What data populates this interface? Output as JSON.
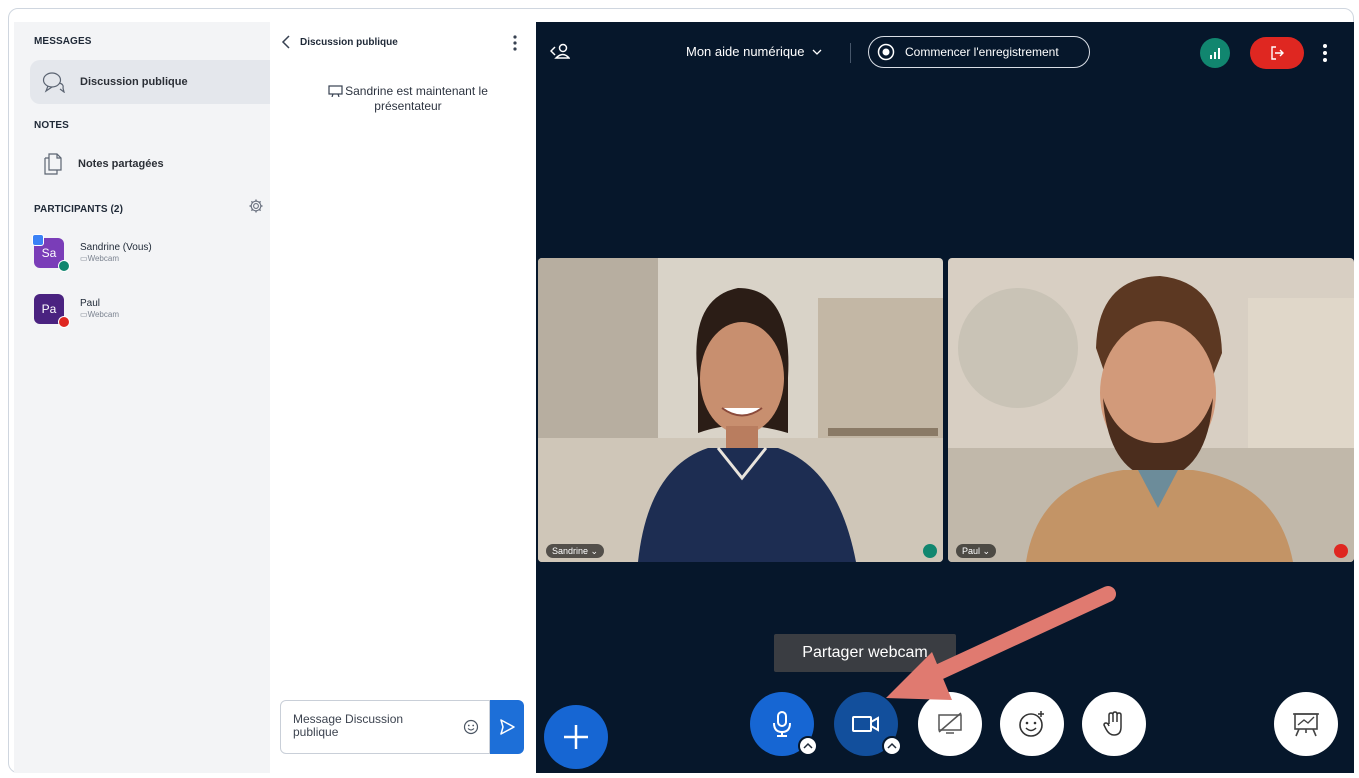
{
  "sidebar": {
    "messages_title": "MESSAGES",
    "public_chat_label": "Discussion publique",
    "notes_title": "NOTES",
    "shared_notes_label": "Notes partagées",
    "participants_title": "PARTICIPANTS (2)",
    "users": [
      {
        "initials": "Sa",
        "name": "Sandrine (Vous)",
        "status": "Webcam",
        "mic": "unmuted"
      },
      {
        "initials": "Pa",
        "name": "Paul",
        "status": "Webcam",
        "mic": "muted"
      }
    ]
  },
  "chat": {
    "title": "Discussion publique",
    "system_message": "Sandrine est maintenant le présentateur",
    "input_placeholder": "Message Discussion publique"
  },
  "meeting": {
    "room_name": "Mon aide numérique",
    "record_label": "Commencer l'enregistrement",
    "tooltip": "Partager webcam",
    "videos": [
      {
        "name": "Sandrine",
        "mic": "unmuted"
      },
      {
        "name": "Paul",
        "mic": "muted"
      }
    ]
  },
  "colors": {
    "meeting_bg": "#06172b",
    "primary_blue": "#1666d3",
    "leave_red": "#df2721",
    "connection_green": "#11866f",
    "annotation_arrow": "#e07a70"
  },
  "icons": [
    "chat-bubbles-icon",
    "notes-icon",
    "gear-icon",
    "user-list-icon",
    "record-icon",
    "connection-bars-icon",
    "leave-icon",
    "microphone-icon",
    "webcam-icon",
    "screen-share-off-icon",
    "reactions-icon",
    "raise-hand-icon",
    "presentation-icon",
    "plus-icon",
    "send-icon",
    "emoji-icon"
  ]
}
